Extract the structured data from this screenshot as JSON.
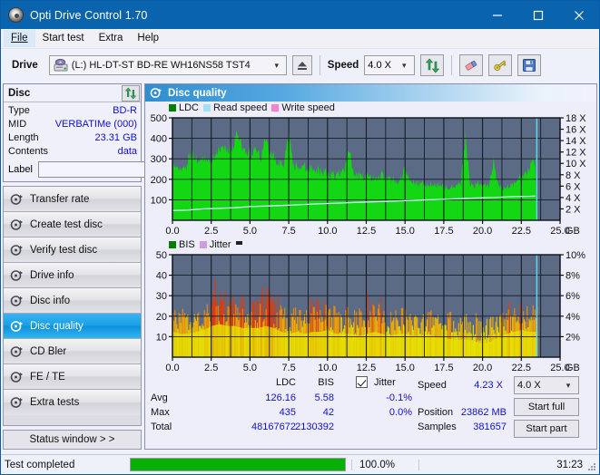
{
  "window": {
    "title": "Opti Drive Control 1.70",
    "icon": "disc-icon",
    "minimize": "minimize-icon",
    "maximize": "maximize-icon",
    "close": "close-icon"
  },
  "menu": {
    "items": [
      {
        "label": "File",
        "active": true
      },
      {
        "label": "Start test",
        "active": false
      },
      {
        "label": "Extra",
        "active": false
      },
      {
        "label": "Help",
        "active": false
      }
    ]
  },
  "toolbar": {
    "drive_label": "Drive",
    "drive_value": "(L:)  HL-DT-ST BD-RE  WH16NS58 TST4",
    "eject_icon": "eject-icon",
    "speed_label": "Speed",
    "speed_value": "4.0 X",
    "refresh_icon": "refresh-icon",
    "eraser_icon": "eraser-icon",
    "key_icon": "key-icon",
    "save_icon": "save-icon"
  },
  "disc_panel": {
    "title": "Disc",
    "refresh_icon": "refresh-icon",
    "rows": [
      {
        "key": "Type",
        "value": "BD-R"
      },
      {
        "key": "MID",
        "value": "VERBATIMe (000)"
      },
      {
        "key": "Length",
        "value": "23.31 GB"
      },
      {
        "key": "Contents",
        "value": "data"
      }
    ],
    "label_key": "Label",
    "label_value": "",
    "label_placeholder": "",
    "label_button_icon": "disc-icon"
  },
  "sidebar": {
    "items": [
      {
        "label": "Transfer rate",
        "icon": "disc-test-icon",
        "selected": false
      },
      {
        "label": "Create test disc",
        "icon": "disc-test-icon",
        "selected": false
      },
      {
        "label": "Verify test disc",
        "icon": "disc-test-icon",
        "selected": false
      },
      {
        "label": "Drive info",
        "icon": "disc-test-icon",
        "selected": false
      },
      {
        "label": "Disc info",
        "icon": "disc-test-icon",
        "selected": false
      },
      {
        "label": "Disc quality",
        "icon": "disc-test-icon",
        "selected": true
      },
      {
        "label": "CD Bler",
        "icon": "disc-test-icon",
        "selected": false
      },
      {
        "label": "FE / TE",
        "icon": "disc-test-icon",
        "selected": false
      },
      {
        "label": "Extra tests",
        "icon": "disc-test-icon",
        "selected": false
      }
    ],
    "status_window": "Status window > >"
  },
  "main": {
    "title": "Disc quality",
    "icon": "disc-test-icon"
  },
  "stats": {
    "col_ldc": "LDC",
    "col_bis": "BIS",
    "row_avg": "Avg",
    "row_max": "Max",
    "row_total": "Total",
    "avg_ldc": "126.16",
    "avg_bis": "5.58",
    "max_ldc": "435",
    "max_bis": "42",
    "total_ldc": "48167672",
    "total_bis": "2130392",
    "jitter_label": "Jitter",
    "jitter_checked": true,
    "jitter_avg": "-0.1%",
    "jitter_max": "0.0%",
    "speed_label": "Speed",
    "speed_value": "4.23 X",
    "position_label": "Position",
    "position_value": "23862 MB",
    "samples_label": "Samples",
    "samples_value": "381657",
    "speed_select": "4.0 X",
    "start_full": "Start full",
    "start_part": "Start part"
  },
  "statusbar": {
    "text": "Test completed",
    "progress": 100,
    "percent": "100.0%",
    "time": "31:23"
  },
  "colors": {
    "titlebar": "#0a63ad",
    "plot_bg": "#5b6b85",
    "ldc_green": "#12d712",
    "read_speed": "#9fe0f5",
    "write_speed": "#ff7fd4",
    "legend_ldc": "#008000",
    "legend_bis": "#008000",
    "legend_jitter": "#c9a0dc",
    "progress_green": "#06b006",
    "value_blue": "#1111cc",
    "selected_nav": "#19a0e6"
  },
  "chart_data": [
    {
      "type": "area",
      "name": "ldc-chart",
      "title": "",
      "xlabel": "GB",
      "ylabel": "",
      "xlim": [
        0,
        25
      ],
      "ylim": [
        0,
        500
      ],
      "y2lim": [
        0,
        18
      ],
      "y2label": "X",
      "xticks": [
        "0.0",
        "2.5",
        "5.0",
        "7.5",
        "10.0",
        "12.5",
        "15.0",
        "17.5",
        "20.0",
        "22.5",
        "25.0"
      ],
      "yticks": [
        100,
        200,
        300,
        400,
        500
      ],
      "y2ticks": [
        "2 X",
        "4 X",
        "6 X",
        "8 X",
        "10 X",
        "12 X",
        "14 X",
        "16 X",
        "18 X"
      ],
      "x_unit": "GB",
      "grid": true,
      "legend": [
        "LDC",
        "Read speed",
        "Write speed"
      ],
      "legend_position": "top-left",
      "data_end_x": 23.5,
      "series": [
        {
          "name": "LDC",
          "color": "#12d712",
          "type": "area",
          "x": [
            0.0,
            0.3,
            0.6,
            0.9,
            1.2,
            1.5,
            1.8,
            2.1,
            2.4,
            2.7,
            3.0,
            3.3,
            3.6,
            3.9,
            4.2,
            4.5,
            4.8,
            5.1,
            5.4,
            5.7,
            6.0,
            6.3,
            6.6,
            6.9,
            7.2,
            7.5,
            7.8,
            8.1,
            8.4,
            8.7,
            9.0,
            9.3,
            9.6,
            9.9,
            10.2,
            10.5,
            10.8,
            11.1,
            11.4,
            11.7,
            12.0,
            12.3,
            12.6,
            12.9,
            13.2,
            13.5,
            13.8,
            14.1,
            14.4,
            14.7,
            15.0,
            15.3,
            15.6,
            15.9,
            16.2,
            16.5,
            16.8,
            17.1,
            17.4,
            17.7,
            18.0,
            18.3,
            18.6,
            18.9,
            19.2,
            19.5,
            19.8,
            20.1,
            20.4,
            20.7,
            21.0,
            21.3,
            21.6,
            21.9,
            22.2,
            22.5,
            22.8,
            23.1,
            23.4
          ],
          "values": [
            288,
            250,
            245,
            262,
            330,
            300,
            275,
            290,
            282,
            310,
            330,
            335,
            345,
            350,
            438,
            340,
            332,
            318,
            345,
            300,
            395,
            318,
            305,
            270,
            265,
            410,
            268,
            262,
            258,
            250,
            245,
            240,
            235,
            230,
            222,
            218,
            228,
            240,
            340,
            232,
            215,
            208,
            205,
            200,
            200,
            215,
            208,
            198,
            192,
            188,
            255,
            185,
            180,
            178,
            175,
            172,
            170,
            168,
            165,
            160,
            158,
            165,
            180,
            405,
            170,
            168,
            185,
            160,
            158,
            288,
            172,
            155,
            160,
            165,
            185,
            210,
            235,
            262,
            288
          ]
        },
        {
          "name": "Read speed",
          "color": "#c8f0fb",
          "type": "line",
          "axis": "right",
          "x": [
            0.0,
            1.0,
            2.0,
            3.0,
            4.0,
            5.0,
            6.0,
            7.0,
            8.0,
            9.0,
            10.0,
            11.0,
            12.0,
            13.0,
            14.0,
            15.0,
            16.0,
            17.0,
            18.0,
            19.0,
            20.0,
            21.0,
            22.0,
            23.0,
            23.4
          ],
          "values": [
            1.7,
            1.8,
            2.0,
            2.1,
            2.2,
            2.4,
            2.5,
            2.6,
            2.7,
            2.85,
            2.95,
            3.05,
            3.15,
            3.25,
            3.35,
            3.45,
            3.55,
            3.65,
            3.75,
            3.85,
            3.95,
            4.05,
            4.15,
            4.2,
            4.25
          ]
        },
        {
          "name": "Write speed",
          "color": "#ff7fd4",
          "type": "line",
          "values": []
        }
      ]
    },
    {
      "type": "bar",
      "name": "bis-chart",
      "title": "",
      "xlabel": "GB",
      "ylabel": "",
      "xlim": [
        0,
        25
      ],
      "ylim": [
        0,
        50
      ],
      "y2lim": [
        0,
        10
      ],
      "y2label": "%",
      "xticks": [
        "0.0",
        "2.5",
        "5.0",
        "7.5",
        "10.0",
        "12.5",
        "15.0",
        "17.5",
        "20.0",
        "22.5",
        "25.0"
      ],
      "yticks": [
        10,
        20,
        30,
        40,
        50
      ],
      "y2ticks": [
        "2%",
        "4%",
        "6%",
        "8%",
        "10%"
      ],
      "x_unit": "GB",
      "grid": true,
      "legend": [
        "BIS",
        "Jitter"
      ],
      "legend_position": "top-left",
      "data_end_x": 23.5,
      "series": [
        {
          "name": "BIS",
          "color_low": "#e8e800",
          "color_high": "#e02000",
          "type": "bar",
          "envelope_x": [
            0.0,
            0.5,
            1.0,
            1.5,
            2.0,
            2.5,
            3.0,
            3.5,
            4.0,
            4.5,
            5.0,
            5.5,
            6.0,
            6.5,
            7.0,
            7.5,
            8.0,
            8.5,
            9.0,
            9.5,
            10.0,
            10.5,
            11.0,
            11.5,
            12.0,
            12.5,
            13.0,
            13.5,
            14.0,
            14.5,
            15.0,
            15.5,
            16.0,
            16.5,
            17.0,
            17.5,
            18.0,
            18.5,
            19.0,
            19.5,
            20.0,
            20.5,
            21.0,
            21.5,
            22.0,
            22.5,
            23.0,
            23.4
          ],
          "envelope_max": [
            26,
            22,
            21,
            24,
            26,
            31,
            38,
            33,
            34,
            32,
            30,
            30,
            42,
            31,
            25,
            24,
            25,
            24,
            27,
            28,
            29,
            25,
            24,
            25,
            23,
            26,
            29,
            25,
            24,
            25,
            26,
            23,
            24,
            25,
            22,
            23,
            22,
            21,
            21,
            20,
            19,
            21,
            22,
            24,
            25,
            26,
            25,
            25
          ],
          "envelope_min": [
            13,
            12,
            12,
            13,
            14,
            16,
            17,
            16,
            16,
            15,
            15,
            15,
            16,
            15,
            13,
            12,
            13,
            12,
            13,
            13,
            14,
            12,
            12,
            12,
            11,
            12,
            13,
            12,
            11,
            12,
            12,
            11,
            11,
            12,
            10,
            10,
            9,
            9,
            9,
            8,
            7,
            8,
            10,
            12,
            13,
            14,
            13,
            13
          ]
        },
        {
          "name": "Jitter",
          "color": "#c9a0dc",
          "type": "line",
          "axis": "right",
          "values": []
        }
      ]
    }
  ]
}
